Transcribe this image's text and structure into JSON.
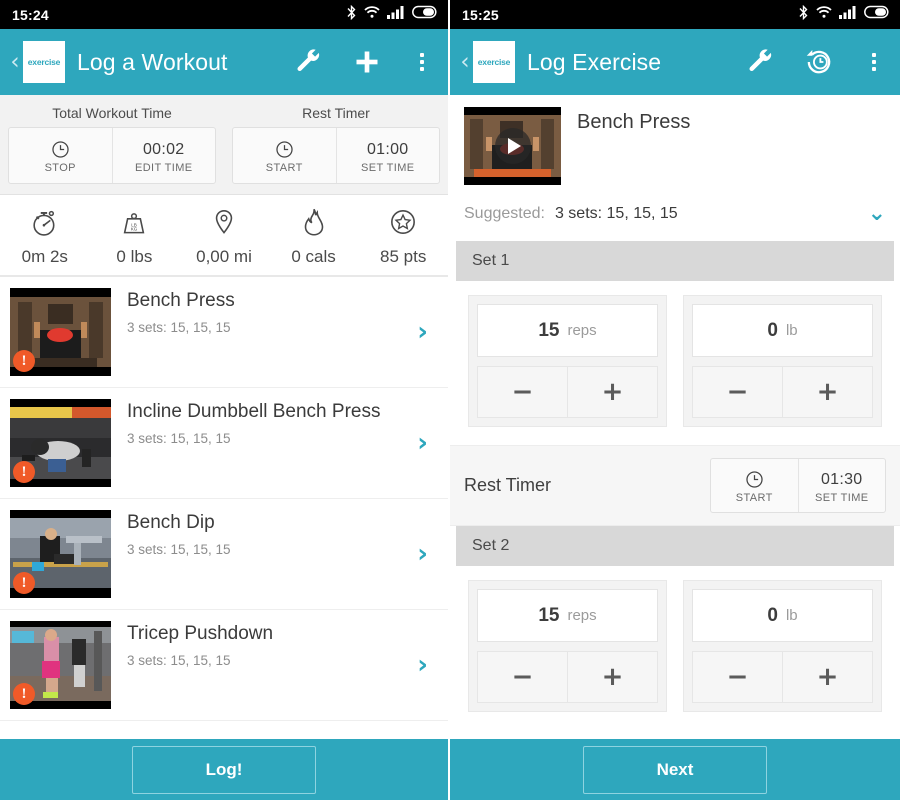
{
  "accent_color": "#2ea7bd",
  "alert_color": "#f05a28",
  "left": {
    "status_bar": {
      "time": "15:24",
      "icons": [
        "bluetooth-icon",
        "wifi-icon",
        "signal-icon",
        "battery-icon"
      ]
    },
    "appbar": {
      "back_label": "‹",
      "logo_text": "exercise",
      "title": "Log a Workout",
      "actions": [
        "wrench-icon",
        "plus-icon",
        "overflow-menu-icon"
      ]
    },
    "total_timer": {
      "caption": "Total Workout Time",
      "action_label": "STOP",
      "value": "00:02",
      "value_sub": "EDIT TIME"
    },
    "rest_timer": {
      "caption": "Rest Timer",
      "action_label": "START",
      "value": "01:00",
      "value_sub": "SET TIME"
    },
    "stats": [
      {
        "icon": "stopwatch-icon",
        "value": "0m  2s"
      },
      {
        "icon": "weight-icon",
        "value": "0 lbs"
      },
      {
        "icon": "location-pin-icon",
        "value": "0,00 mi"
      },
      {
        "icon": "flame-icon",
        "value": "0 cals"
      },
      {
        "icon": "star-badge-icon",
        "value": "85 pts"
      }
    ],
    "exercises": [
      {
        "name": "Bench Press",
        "sets": "3 sets: 15, 15, 15",
        "badge": "!",
        "thumb": "bench-press-thumb"
      },
      {
        "name": "Incline Dumbbell Bench Press",
        "sets": "3 sets: 15, 15, 15",
        "badge": "!",
        "thumb": "incline-dumbbell-thumb"
      },
      {
        "name": "Bench Dip",
        "sets": "3 sets: 15, 15, 15",
        "badge": "!",
        "thumb": "bench-dip-thumb"
      },
      {
        "name": "Tricep Pushdown",
        "sets": "3 sets: 15, 15, 15",
        "badge": "!",
        "thumb": "tricep-pushdown-thumb"
      }
    ],
    "cta_label": "Log!"
  },
  "right": {
    "status_bar": {
      "time": "15:25",
      "icons": [
        "bluetooth-icon",
        "wifi-icon",
        "signal-icon",
        "battery-icon"
      ]
    },
    "appbar": {
      "back_label": "‹",
      "logo_text": "exercise",
      "title": "Log Exercise",
      "actions": [
        "wrench-icon",
        "history-icon",
        "overflow-menu-icon"
      ]
    },
    "exercise": {
      "name": "Bench Press",
      "thumb": "bench-press-video-thumb",
      "suggested_label": "Suggested:",
      "suggested_value": "3 sets: 15, 15, 15",
      "expand_icon": "chevron-down-icon"
    },
    "sets": [
      {
        "title": "Set 1",
        "reps": {
          "value": "15",
          "unit": "reps",
          "minus": "−",
          "plus": "+"
        },
        "weight": {
          "value": "0",
          "unit": "lb",
          "minus": "−",
          "plus": "+"
        }
      },
      {
        "title": "Set 2",
        "reps": {
          "value": "15",
          "unit": "reps",
          "minus": "−",
          "plus": "+"
        },
        "weight": {
          "value": "0",
          "unit": "lb",
          "minus": "−",
          "plus": "+"
        }
      }
    ],
    "rest_timer": {
      "label": "Rest Timer",
      "action_label": "START",
      "value": "01:30",
      "value_sub": "SET TIME"
    },
    "cta_label": "Next"
  }
}
